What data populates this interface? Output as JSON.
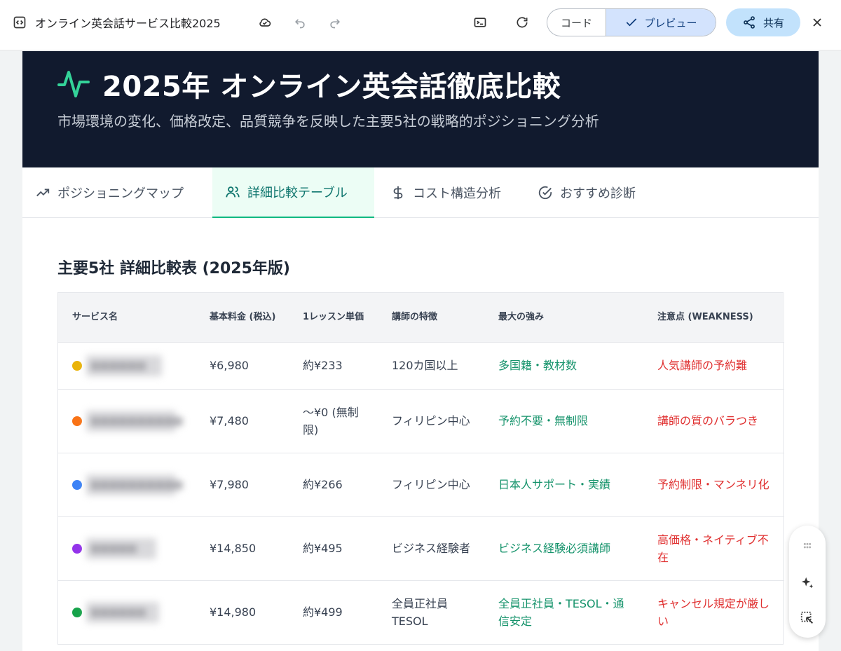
{
  "toolbar": {
    "title": "オンライン英会話サービス比較2025",
    "code_label": "コード",
    "preview_label": "プレビュー",
    "share_label": "共有"
  },
  "hero": {
    "title": "2025年 オンライン英会話徹底比較",
    "subtitle": "市場環境の変化、価格改定、品質競争を反映した主要5社の戦略的ポジショニング分析",
    "accent_color": "#34d399"
  },
  "tabs": [
    {
      "label": "ポジショニングマップ",
      "icon": "trend-icon"
    },
    {
      "label": "詳細比較テーブル",
      "icon": "users-icon",
      "active": true
    },
    {
      "label": "コスト構造分析",
      "icon": "dollar-icon"
    },
    {
      "label": "おすすめ診断",
      "icon": "check-circle-icon"
    }
  ],
  "section": {
    "title": "主要5社 詳細比較表 (2025年版)"
  },
  "table": {
    "headers": [
      "サービス名",
      "基本料金 (税込)",
      "1レッスン単価",
      "講師の特徴",
      "最大の強み",
      "注意点 (WEAKNESS)"
    ],
    "rows": [
      {
        "color": "#eab308",
        "service": "■■■■■■",
        "price": "¥6,980",
        "unit": "約¥233",
        "teacher": "120カ国以上",
        "strength": "多国籍・教材数",
        "weakness": "人気講師の予約難"
      },
      {
        "color": "#f97316",
        "service": "■■■■■■■■■■",
        "price": "¥7,480",
        "unit": "〜¥0 (無制限)",
        "teacher": "フィリピン中心",
        "strength": "予約不要・無制限",
        "weakness": "講師の質のバラつき"
      },
      {
        "color": "#3b82f6",
        "service": "■■■■■■■■■■",
        "price": "¥7,980",
        "unit": "約¥266",
        "teacher": "フィリピン中心",
        "strength": "日本人サポート・実績",
        "weakness": "予約制限・マンネリ化"
      },
      {
        "color": "#9333ea",
        "service": "■■■■■",
        "price": "¥14,850",
        "unit": "約¥495",
        "teacher": "ビジネス経験者",
        "strength": "ビジネス経験必須講師",
        "weakness": "高価格・ネイティブ不在"
      },
      {
        "color": "#16a34a",
        "service": "■■■■■■",
        "price": "¥14,980",
        "unit": "約¥499",
        "teacher": "全員正社員 TESOL",
        "strength": "全員正社員・TESOL・通信安定",
        "weakness": "キャンセル規定が厳しい"
      }
    ]
  }
}
